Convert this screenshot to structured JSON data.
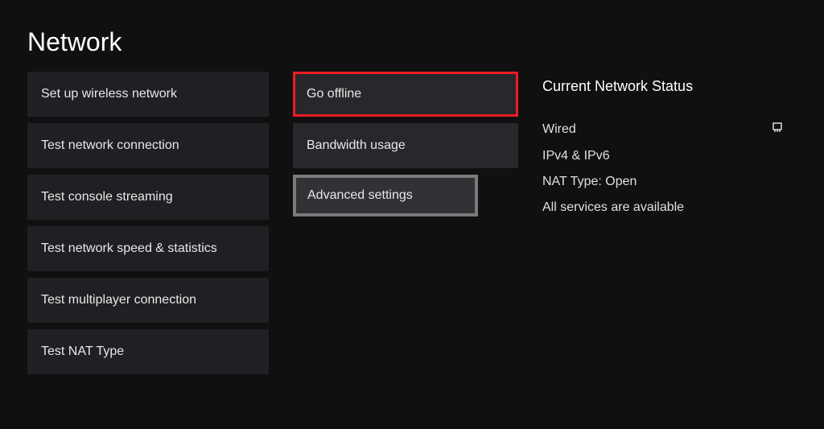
{
  "title": "Network",
  "left_column": {
    "items": [
      {
        "label": "Set up wireless network"
      },
      {
        "label": "Test network connection"
      },
      {
        "label": "Test console streaming"
      },
      {
        "label": "Test network speed & statistics"
      },
      {
        "label": "Test multiplayer connection"
      },
      {
        "label": "Test NAT Type"
      }
    ]
  },
  "middle_column": {
    "items": [
      {
        "label": "Go offline",
        "highlight": "red"
      },
      {
        "label": "Bandwidth usage"
      },
      {
        "label": "Advanced settings",
        "highlight": "grey"
      }
    ]
  },
  "status": {
    "title": "Current Network Status",
    "connection_type": "Wired",
    "ip_version": "IPv4 & IPv6",
    "nat_type": "NAT Type: Open",
    "services": "All services are available"
  }
}
